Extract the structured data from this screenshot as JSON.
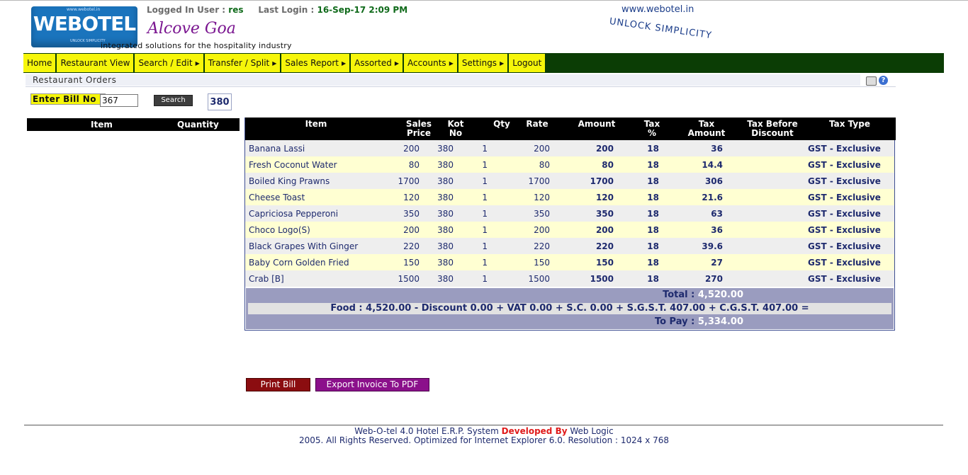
{
  "header": {
    "logo_url_text": "www.webotel.in",
    "logo_text": "WEBOTEL",
    "logo_tag": "UNLOCK SIMPLICITY",
    "logged_in_label": "Logged In User :",
    "logged_in_user": "res",
    "last_login_label": "Last Login :",
    "last_login_value": "16-Sep-17 2:09 PM",
    "hotel_name": "Alcove Goa",
    "tagline": "integrated solutions for the hospitality industry",
    "site_url": "www.webotel.in",
    "slogan": "UNLOCK SIMPLICITY"
  },
  "menu": [
    {
      "label": "Home",
      "arrow": false
    },
    {
      "label": "Restaurant View",
      "arrow": false
    },
    {
      "label": "Search / Edit",
      "arrow": true
    },
    {
      "label": "Transfer / Split",
      "arrow": true
    },
    {
      "label": "Sales Report",
      "arrow": true
    },
    {
      "label": "Assorted",
      "arrow": true
    },
    {
      "label": "Accounts",
      "arrow": true
    },
    {
      "label": "Settings",
      "arrow": true
    },
    {
      "label": "Logout",
      "arrow": false
    }
  ],
  "section": {
    "title": "Restaurant Orders"
  },
  "bill": {
    "label": "Enter Bill No :",
    "value": "367",
    "search_label": "Search",
    "badge": "380"
  },
  "left_table": {
    "headers": [
      "Item",
      "Quantity"
    ]
  },
  "main_table": {
    "headers": [
      "Item",
      "Sales Price",
      "Kot No",
      "Qty",
      "Rate",
      "Amount",
      "Tax %",
      "Tax Amount",
      "Tax Before Discount",
      "Tax Type"
    ],
    "rows": [
      {
        "item": "Banana Lassi",
        "price": "200",
        "kot": "380",
        "qty": "1",
        "rate": "200",
        "amount": "200",
        "tax": "18",
        "tax_amount": "36",
        "before": "",
        "type": "GST - Exclusive"
      },
      {
        "item": "Fresh Coconut Water",
        "price": "80",
        "kot": "380",
        "qty": "1",
        "rate": "80",
        "amount": "80",
        "tax": "18",
        "tax_amount": "14.4",
        "before": "",
        "type": "GST - Exclusive"
      },
      {
        "item": "Boiled King Prawns",
        "price": "1700",
        "kot": "380",
        "qty": "1",
        "rate": "1700",
        "amount": "1700",
        "tax": "18",
        "tax_amount": "306",
        "before": "",
        "type": "GST - Exclusive"
      },
      {
        "item": "Cheese Toast",
        "price": "120",
        "kot": "380",
        "qty": "1",
        "rate": "120",
        "amount": "120",
        "tax": "18",
        "tax_amount": "21.6",
        "before": "",
        "type": "GST - Exclusive"
      },
      {
        "item": "Capriciosa Pepperoni",
        "price": "350",
        "kot": "380",
        "qty": "1",
        "rate": "350",
        "amount": "350",
        "tax": "18",
        "tax_amount": "63",
        "before": "",
        "type": "GST - Exclusive"
      },
      {
        "item": "Choco Logo(S)",
        "price": "200",
        "kot": "380",
        "qty": "1",
        "rate": "200",
        "amount": "200",
        "tax": "18",
        "tax_amount": "36",
        "before": "",
        "type": "GST - Exclusive"
      },
      {
        "item": "Black Grapes With Ginger",
        "price": "220",
        "kot": "380",
        "qty": "1",
        "rate": "220",
        "amount": "220",
        "tax": "18",
        "tax_amount": "39.6",
        "before": "",
        "type": "GST - Exclusive"
      },
      {
        "item": "Baby Corn Golden Fried",
        "price": "150",
        "kot": "380",
        "qty": "1",
        "rate": "150",
        "amount": "150",
        "tax": "18",
        "tax_amount": "27",
        "before": "",
        "type": "GST - Exclusive"
      },
      {
        "item": "Crab [B]",
        "price": "1500",
        "kot": "380",
        "qty": "1",
        "rate": "1500",
        "amount": "1500",
        "tax": "18",
        "tax_amount": "270",
        "before": "",
        "type": "GST - Exclusive"
      }
    ],
    "total_label": "Total :",
    "total_value": "4,520.00",
    "summary": "Food : 4,520.00 - Discount 0.00 + VAT 0.00 + S.C. 0.00 + S.G.S.T. 407.00 + C.G.S.T. 407.00 =",
    "topay_label": "To Pay :",
    "topay_value": "5,334.00"
  },
  "actions": {
    "print": "Print Bill",
    "export": "Export Invoice To PDF"
  },
  "footer": {
    "line1_a": "Web-O-tel 4.0 Hotel E.R.P. System",
    "line1_b": "Developed By",
    "line1_c": "Web Logic",
    "line2": "2005. All Rights Reserved. Optimized for Internet Explorer 6.0.  Resolution : 1024 x 768"
  },
  "colors": {
    "menu_bg": "#0b3d05",
    "menu_item": "#f6f60a",
    "accent": "#1e2a6e",
    "print_btn": "#8b0d10",
    "export_btn": "#8b108b"
  },
  "icons": [
    "printer-icon",
    "help-icon"
  ]
}
